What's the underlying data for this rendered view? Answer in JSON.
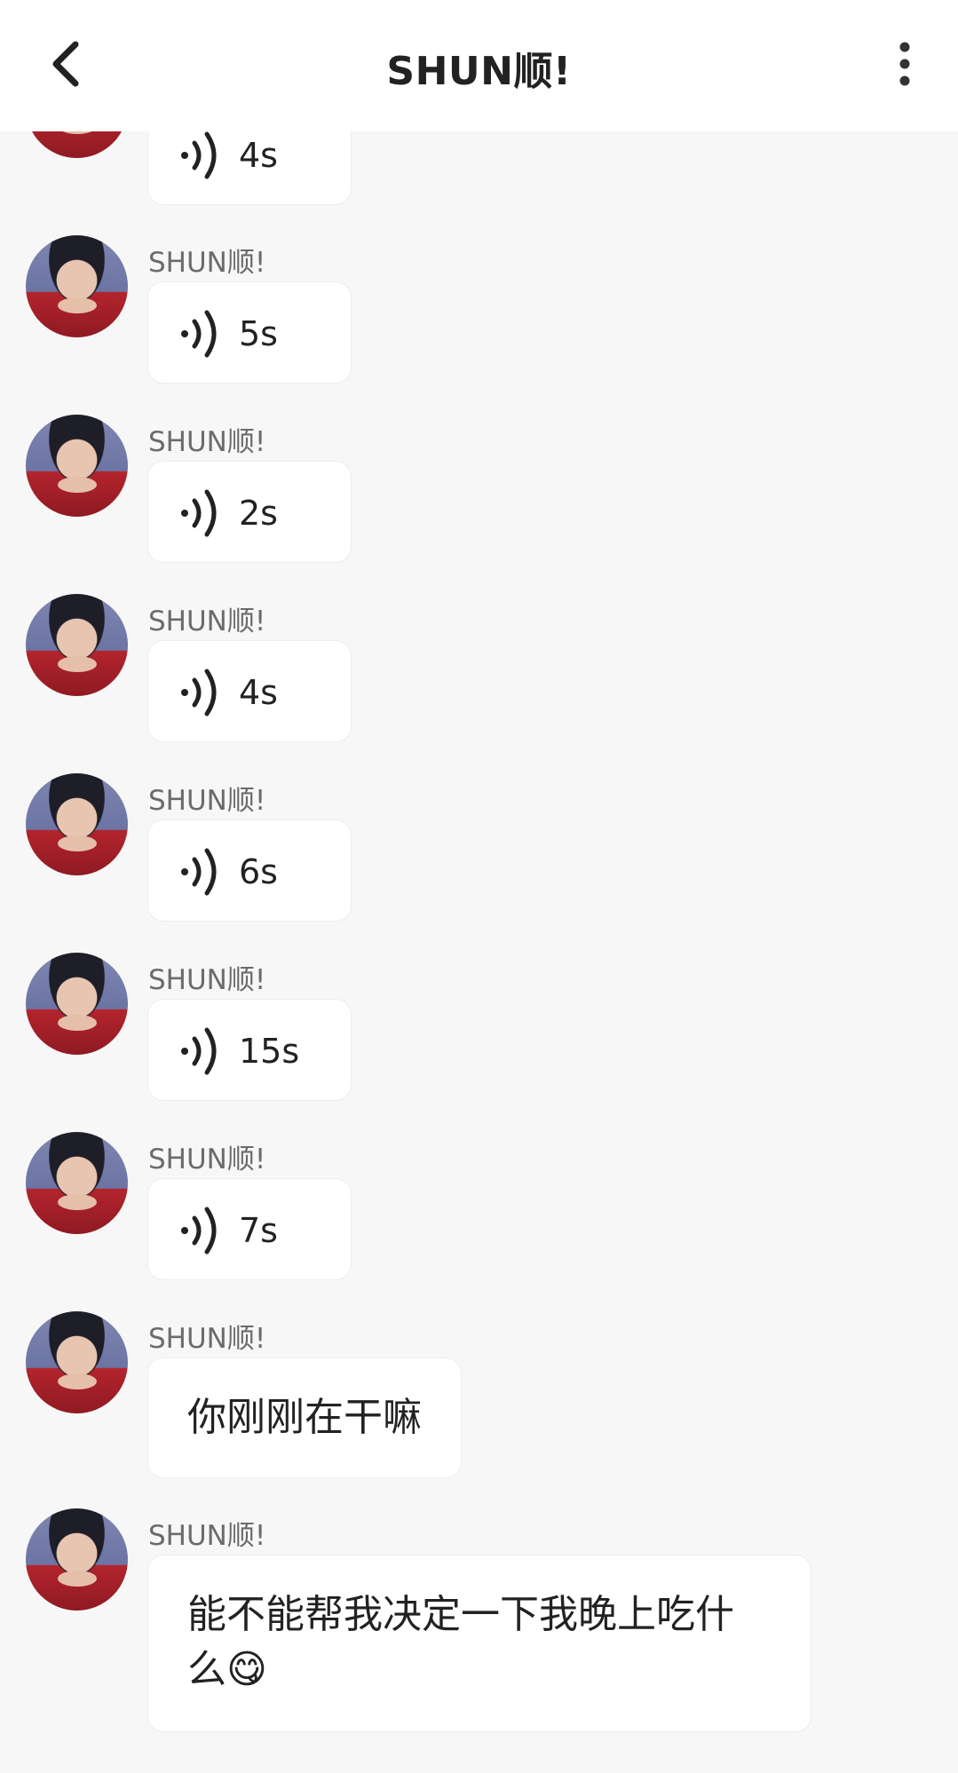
{
  "header": {
    "title": "SHUN顺!",
    "back_icon": "chevron-left-icon",
    "more_icon": "more-vertical-icon"
  },
  "messages": [
    {
      "type": "voice",
      "sender": "",
      "duration": "4s"
    },
    {
      "type": "voice",
      "sender": "SHUN顺!",
      "duration": "5s"
    },
    {
      "type": "voice",
      "sender": "SHUN顺!",
      "duration": "2s"
    },
    {
      "type": "voice",
      "sender": "SHUN顺!",
      "duration": "4s"
    },
    {
      "type": "voice",
      "sender": "SHUN顺!",
      "duration": "6s"
    },
    {
      "type": "voice",
      "sender": "SHUN顺!",
      "duration": "15s"
    },
    {
      "type": "voice",
      "sender": "SHUN顺!",
      "duration": "7s"
    },
    {
      "type": "text",
      "sender": "SHUN顺!",
      "text": "你刚刚在干嘛"
    },
    {
      "type": "text",
      "sender": "SHUN顺!",
      "text": "能不能帮我决定一下我晚上吃什么😋"
    }
  ],
  "colors": {
    "background": "#f7f7f7",
    "header": "#ffffff",
    "bubble": "#ffffff",
    "sender_text": "#6b6b6b",
    "primary_text": "#222222"
  }
}
